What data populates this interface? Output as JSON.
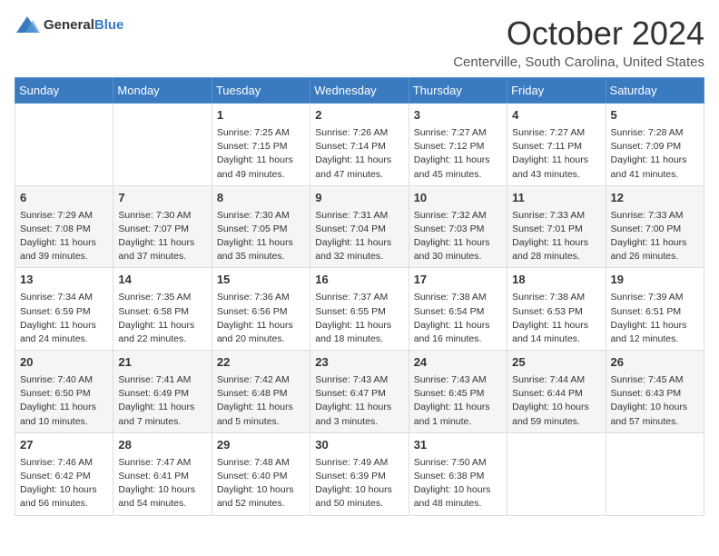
{
  "header": {
    "logo_general": "General",
    "logo_blue": "Blue",
    "title": "October 2024",
    "location": "Centerville, South Carolina, United States"
  },
  "days_of_week": [
    "Sunday",
    "Monday",
    "Tuesday",
    "Wednesday",
    "Thursday",
    "Friday",
    "Saturday"
  ],
  "weeks": [
    [
      {
        "day": "",
        "info": ""
      },
      {
        "day": "",
        "info": ""
      },
      {
        "day": "1",
        "info": "Sunrise: 7:25 AM\nSunset: 7:15 PM\nDaylight: 11 hours and 49 minutes."
      },
      {
        "day": "2",
        "info": "Sunrise: 7:26 AM\nSunset: 7:14 PM\nDaylight: 11 hours and 47 minutes."
      },
      {
        "day": "3",
        "info": "Sunrise: 7:27 AM\nSunset: 7:12 PM\nDaylight: 11 hours and 45 minutes."
      },
      {
        "day": "4",
        "info": "Sunrise: 7:27 AM\nSunset: 7:11 PM\nDaylight: 11 hours and 43 minutes."
      },
      {
        "day": "5",
        "info": "Sunrise: 7:28 AM\nSunset: 7:09 PM\nDaylight: 11 hours and 41 minutes."
      }
    ],
    [
      {
        "day": "6",
        "info": "Sunrise: 7:29 AM\nSunset: 7:08 PM\nDaylight: 11 hours and 39 minutes."
      },
      {
        "day": "7",
        "info": "Sunrise: 7:30 AM\nSunset: 7:07 PM\nDaylight: 11 hours and 37 minutes."
      },
      {
        "day": "8",
        "info": "Sunrise: 7:30 AM\nSunset: 7:05 PM\nDaylight: 11 hours and 35 minutes."
      },
      {
        "day": "9",
        "info": "Sunrise: 7:31 AM\nSunset: 7:04 PM\nDaylight: 11 hours and 32 minutes."
      },
      {
        "day": "10",
        "info": "Sunrise: 7:32 AM\nSunset: 7:03 PM\nDaylight: 11 hours and 30 minutes."
      },
      {
        "day": "11",
        "info": "Sunrise: 7:33 AM\nSunset: 7:01 PM\nDaylight: 11 hours and 28 minutes."
      },
      {
        "day": "12",
        "info": "Sunrise: 7:33 AM\nSunset: 7:00 PM\nDaylight: 11 hours and 26 minutes."
      }
    ],
    [
      {
        "day": "13",
        "info": "Sunrise: 7:34 AM\nSunset: 6:59 PM\nDaylight: 11 hours and 24 minutes."
      },
      {
        "day": "14",
        "info": "Sunrise: 7:35 AM\nSunset: 6:58 PM\nDaylight: 11 hours and 22 minutes."
      },
      {
        "day": "15",
        "info": "Sunrise: 7:36 AM\nSunset: 6:56 PM\nDaylight: 11 hours and 20 minutes."
      },
      {
        "day": "16",
        "info": "Sunrise: 7:37 AM\nSunset: 6:55 PM\nDaylight: 11 hours and 18 minutes."
      },
      {
        "day": "17",
        "info": "Sunrise: 7:38 AM\nSunset: 6:54 PM\nDaylight: 11 hours and 16 minutes."
      },
      {
        "day": "18",
        "info": "Sunrise: 7:38 AM\nSunset: 6:53 PM\nDaylight: 11 hours and 14 minutes."
      },
      {
        "day": "19",
        "info": "Sunrise: 7:39 AM\nSunset: 6:51 PM\nDaylight: 11 hours and 12 minutes."
      }
    ],
    [
      {
        "day": "20",
        "info": "Sunrise: 7:40 AM\nSunset: 6:50 PM\nDaylight: 11 hours and 10 minutes."
      },
      {
        "day": "21",
        "info": "Sunrise: 7:41 AM\nSunset: 6:49 PM\nDaylight: 11 hours and 7 minutes."
      },
      {
        "day": "22",
        "info": "Sunrise: 7:42 AM\nSunset: 6:48 PM\nDaylight: 11 hours and 5 minutes."
      },
      {
        "day": "23",
        "info": "Sunrise: 7:43 AM\nSunset: 6:47 PM\nDaylight: 11 hours and 3 minutes."
      },
      {
        "day": "24",
        "info": "Sunrise: 7:43 AM\nSunset: 6:45 PM\nDaylight: 11 hours and 1 minute."
      },
      {
        "day": "25",
        "info": "Sunrise: 7:44 AM\nSunset: 6:44 PM\nDaylight: 10 hours and 59 minutes."
      },
      {
        "day": "26",
        "info": "Sunrise: 7:45 AM\nSunset: 6:43 PM\nDaylight: 10 hours and 57 minutes."
      }
    ],
    [
      {
        "day": "27",
        "info": "Sunrise: 7:46 AM\nSunset: 6:42 PM\nDaylight: 10 hours and 56 minutes."
      },
      {
        "day": "28",
        "info": "Sunrise: 7:47 AM\nSunset: 6:41 PM\nDaylight: 10 hours and 54 minutes."
      },
      {
        "day": "29",
        "info": "Sunrise: 7:48 AM\nSunset: 6:40 PM\nDaylight: 10 hours and 52 minutes."
      },
      {
        "day": "30",
        "info": "Sunrise: 7:49 AM\nSunset: 6:39 PM\nDaylight: 10 hours and 50 minutes."
      },
      {
        "day": "31",
        "info": "Sunrise: 7:50 AM\nSunset: 6:38 PM\nDaylight: 10 hours and 48 minutes."
      },
      {
        "day": "",
        "info": ""
      },
      {
        "day": "",
        "info": ""
      }
    ]
  ]
}
